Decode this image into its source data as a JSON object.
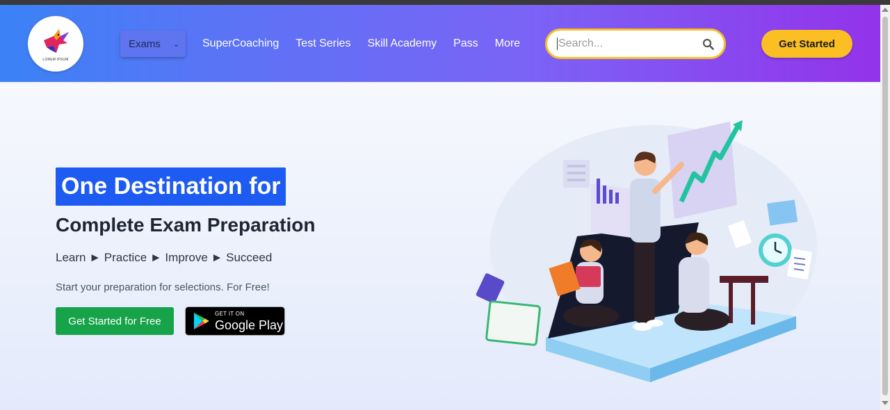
{
  "logo": {
    "text": "LOREM IPSUM"
  },
  "nav": {
    "exams_label": "Exams",
    "links": [
      "SuperCoaching",
      "Test Series",
      "Skill Academy",
      "Pass",
      "More"
    ]
  },
  "search": {
    "placeholder": "Search...",
    "icon": "search-icon"
  },
  "header": {
    "cta_label": "Get Started"
  },
  "hero": {
    "highlight": "One Destination for",
    "subtitle": "Complete Exam Preparation",
    "steps": "Learn ► Practice ► Improve ► Succeed",
    "tagline": "Start your preparation for selections. For Free!",
    "cta_free": "Get Started for Free",
    "play_small": "GET IT ON",
    "play_big": "Google Play"
  },
  "colors": {
    "header_gradient_start": "#3b82f6",
    "header_gradient_end": "#9333ea",
    "highlight_bg": "#1d5bf2",
    "cta_yellow": "#fbbf24",
    "cta_green": "#16a34a"
  }
}
